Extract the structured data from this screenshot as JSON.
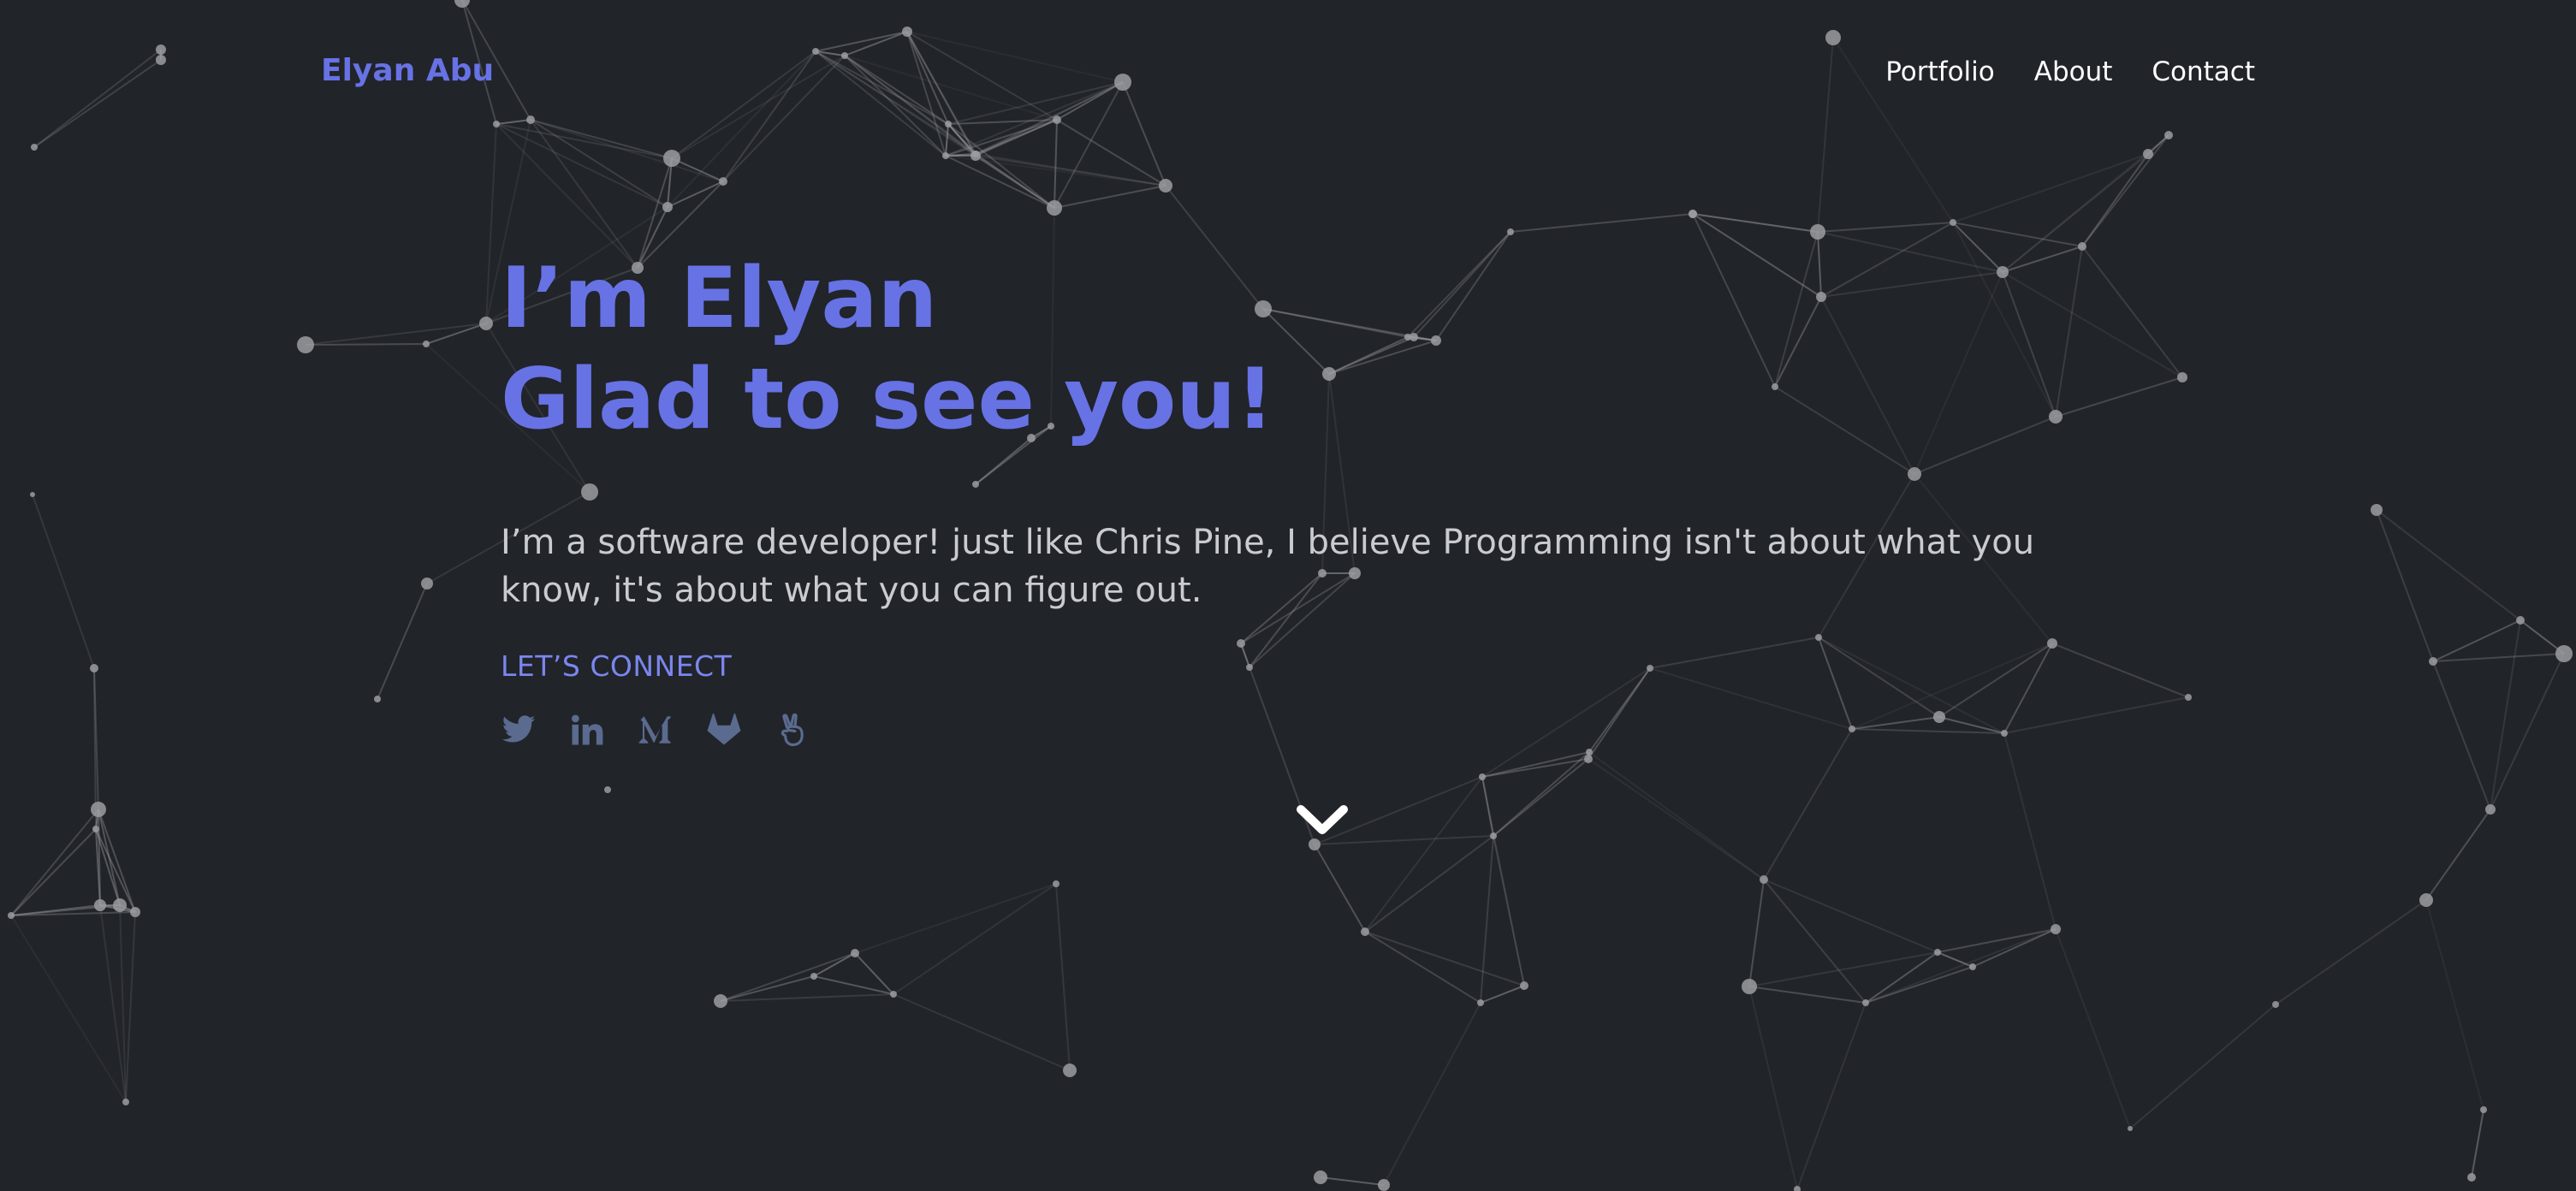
{
  "header": {
    "brand": "Elyan Abu",
    "nav": [
      {
        "label": "Portfolio"
      },
      {
        "label": "About"
      },
      {
        "label": "Contact"
      }
    ]
  },
  "hero": {
    "headline_line1": "I’m Elyan",
    "headline_line2": "Glad to see you!",
    "description": "I’m a software developer! just like Chris Pine, I believe Programming isn't about what you know, it's about what you can figure out.",
    "cta_label": "LET’S CONNECT"
  },
  "socials": [
    {
      "icon": "twitter-icon"
    },
    {
      "icon": "linkedin-icon"
    },
    {
      "icon": "medium-icon"
    },
    {
      "icon": "gitlab-icon"
    },
    {
      "icon": "angellist-icon"
    }
  ],
  "scroll": {
    "icon": "chevron-down-icon"
  },
  "colors": {
    "background": "#212429",
    "accent": "#6772e5",
    "text_muted": "#c9cbd0",
    "icon_muted": "#5a6b8f",
    "particle": "#9a9ca0"
  }
}
